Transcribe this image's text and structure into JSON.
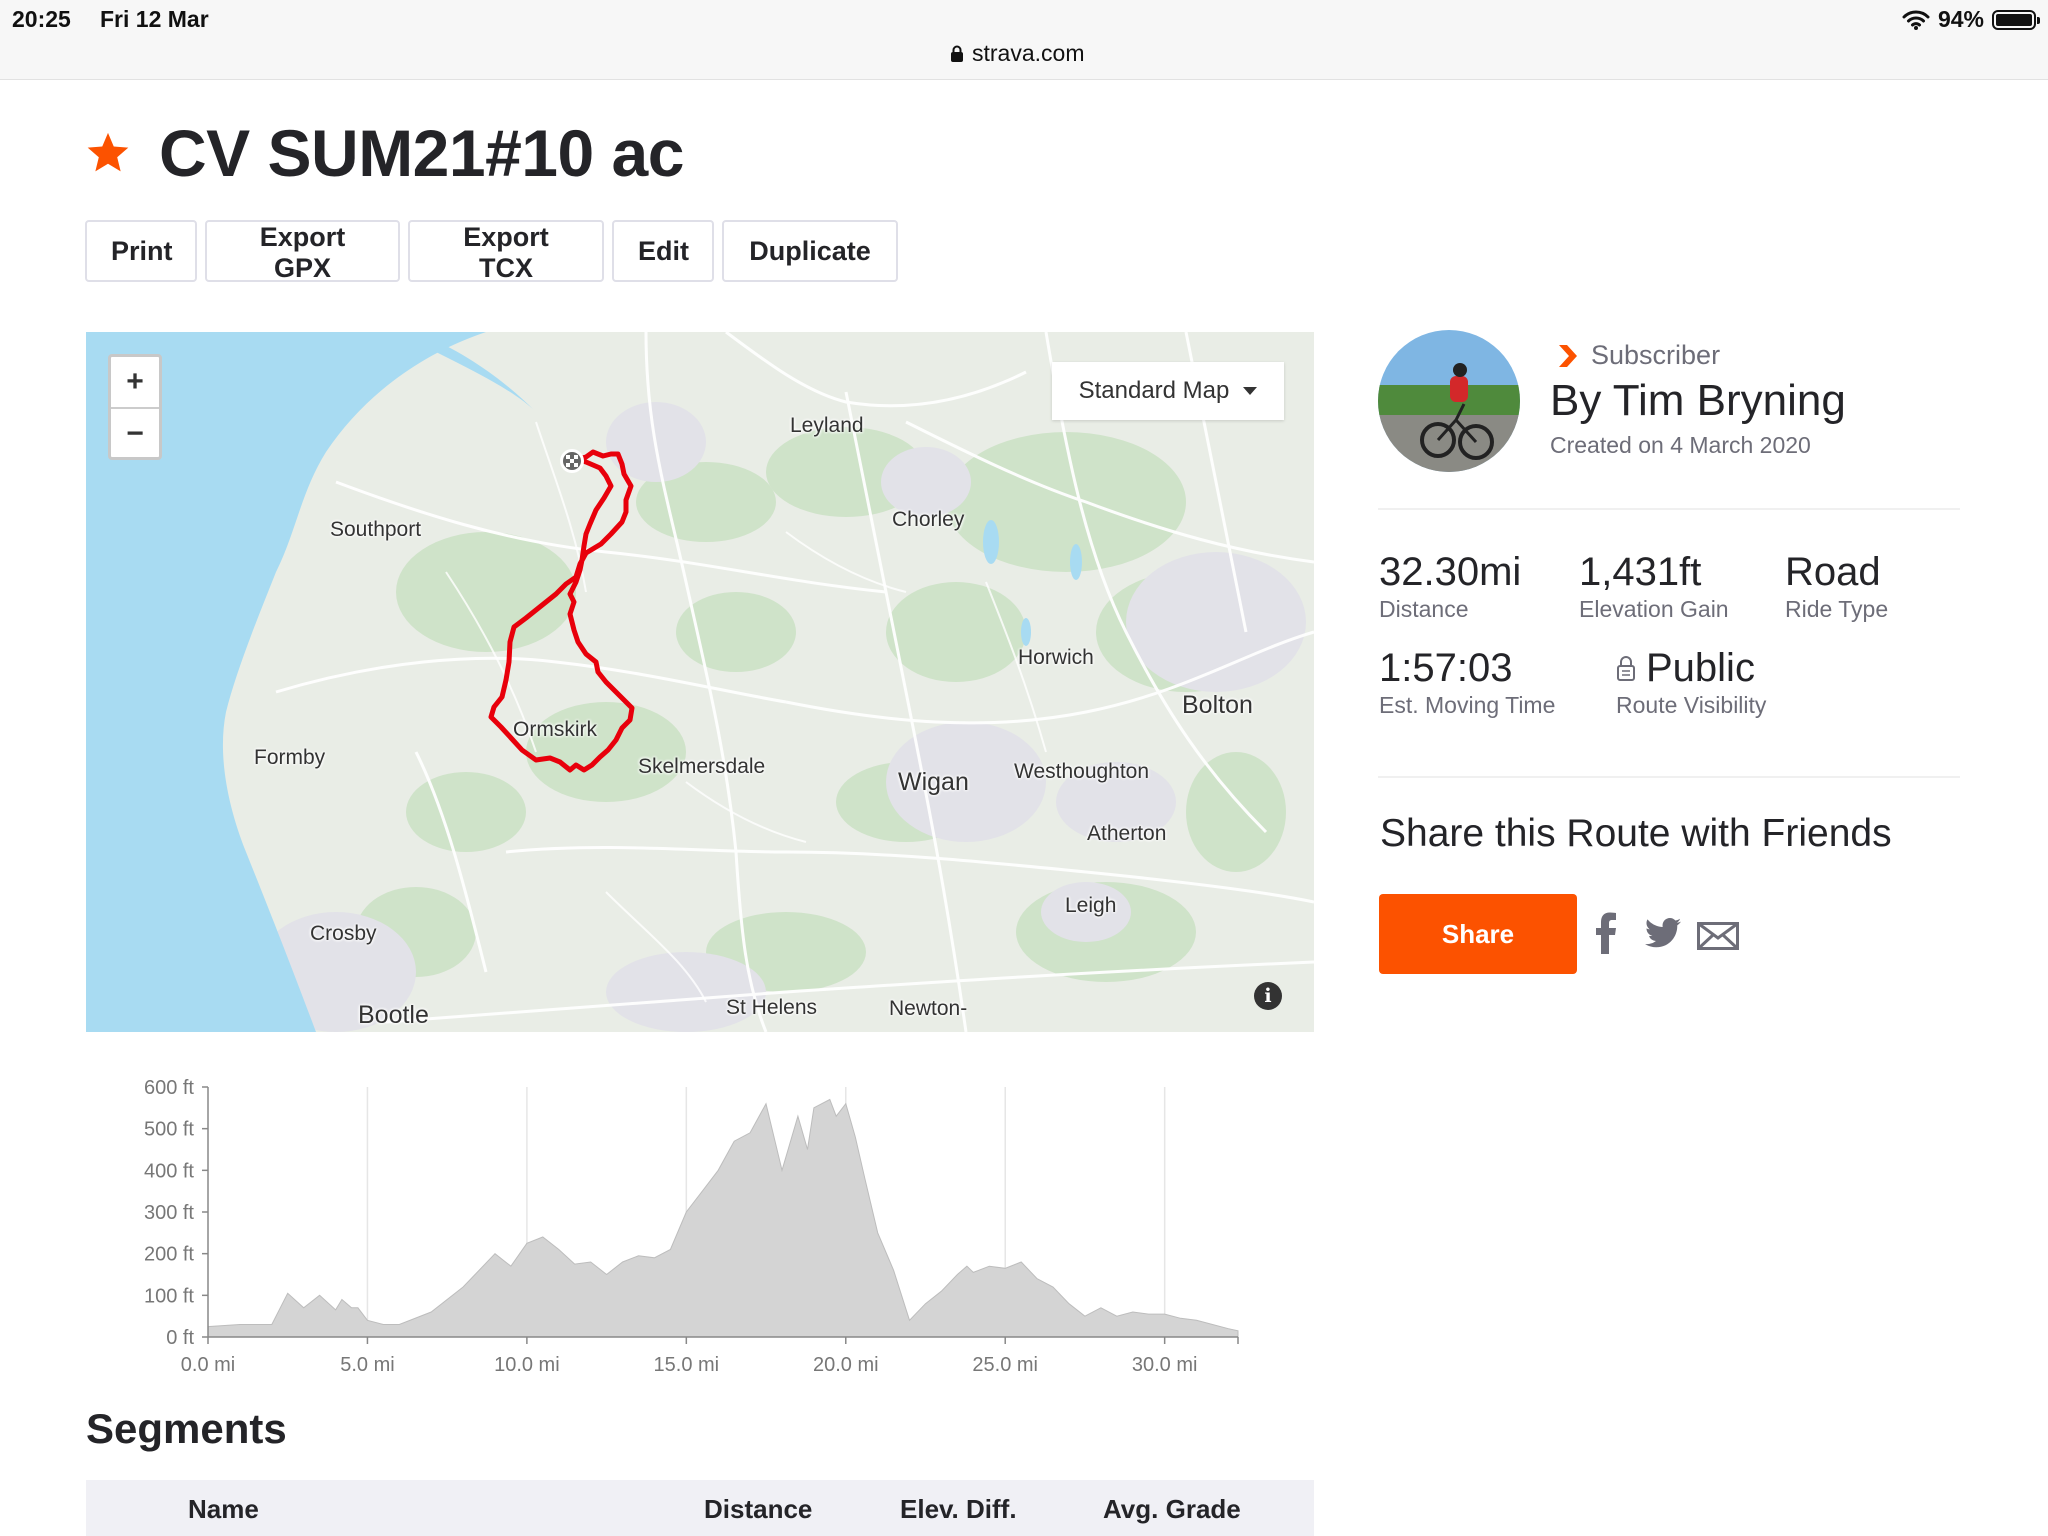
{
  "status_bar": {
    "time": "20:25",
    "date": "Fri 12 Mar",
    "url": "strava.com",
    "battery": "94%"
  },
  "route": {
    "title": "CV SUM21#10 ac"
  },
  "actions": {
    "print": "Print",
    "export_gpx": "Export GPX",
    "export_tcx": "Export TCX",
    "edit": "Edit",
    "duplicate": "Duplicate"
  },
  "map": {
    "zoom_in": "+",
    "zoom_out": "−",
    "map_type": "Standard Map",
    "info": "i",
    "places": {
      "leyland": "Leyland",
      "southport": "Southport",
      "chorley": "Chorley",
      "horwich": "Horwich",
      "bolton": "Bolton",
      "ormskirk": "Ormskirk",
      "formby": "Formby",
      "skelmersdale": "Skelmersdale",
      "wigan": "Wigan",
      "westhoughton": "Westhoughton",
      "atherton": "Atherton",
      "leigh": "Leigh",
      "crosby": "Crosby",
      "bootle": "Bootle",
      "st_helens": "St Helens",
      "newton": "Newton-"
    }
  },
  "elevation": {
    "y_ticks": [
      "600 ft",
      "500 ft",
      "400 ft",
      "300 ft",
      "200 ft",
      "100 ft",
      "0 ft"
    ],
    "x_ticks": [
      "0.0 mi",
      "5.0 mi",
      "10.0 mi",
      "15.0 mi",
      "20.0 mi",
      "25.0 mi",
      "30.0 mi"
    ]
  },
  "chart_data": {
    "type": "area",
    "xlabel": "",
    "ylabel": "",
    "xlim": [
      0,
      32.3
    ],
    "ylim": [
      0,
      600
    ],
    "x": [
      0,
      1,
      2,
      2.5,
      3,
      3.5,
      4,
      4.2,
      4.5,
      4.7,
      5,
      5.5,
      6,
      7,
      8,
      9,
      9.5,
      10,
      10.5,
      11,
      11.5,
      12,
      12.5,
      13,
      13.5,
      14,
      14.5,
      15,
      15.5,
      16,
      16.5,
      17,
      17.5,
      18,
      18.5,
      18.8,
      19,
      19.5,
      19.7,
      20,
      20.3,
      20.6,
      21,
      21.5,
      22,
      22.5,
      23,
      23.5,
      23.8,
      24,
      24.5,
      25,
      25.5,
      26,
      26.5,
      27,
      27.5,
      28,
      28.5,
      29,
      29.5,
      30,
      30.5,
      31,
      31.5,
      32,
      32.3
    ],
    "values": [
      25,
      30,
      30,
      105,
      70,
      100,
      65,
      90,
      70,
      70,
      40,
      30,
      30,
      60,
      120,
      200,
      170,
      225,
      240,
      210,
      175,
      180,
      150,
      180,
      195,
      190,
      210,
      300,
      350,
      400,
      470,
      490,
      560,
      400,
      530,
      450,
      550,
      570,
      530,
      560,
      480,
      380,
      250,
      160,
      40,
      80,
      110,
      150,
      170,
      155,
      170,
      165,
      180,
      140,
      120,
      80,
      50,
      70,
      50,
      60,
      55,
      55,
      45,
      40,
      30,
      20,
      15
    ]
  },
  "segments": {
    "title": "Segments",
    "columns": [
      "Name",
      "Distance",
      "Elev. Diff.",
      "Avg. Grade"
    ]
  },
  "author": {
    "badge": "Subscriber",
    "name": "By Tim Bryning",
    "created": "Created on 4 March 2020"
  },
  "stats": {
    "distance": {
      "value": "32.30mi",
      "label": "Distance"
    },
    "elevation_gain": {
      "value": "1,431ft",
      "label": "Elevation Gain"
    },
    "ride_type": {
      "value": "Road",
      "label": "Ride Type"
    },
    "moving_time": {
      "value": "1:57:03",
      "label": "Est. Moving Time"
    },
    "visibility": {
      "value": "Public",
      "label": "Route Visibility"
    }
  },
  "share": {
    "title": "Share this Route with Friends",
    "button": "Share"
  },
  "colors": {
    "brand": "#fc5200",
    "route": "#e8000b",
    "water": "#a8dbf2",
    "land": "#e7ece5"
  }
}
